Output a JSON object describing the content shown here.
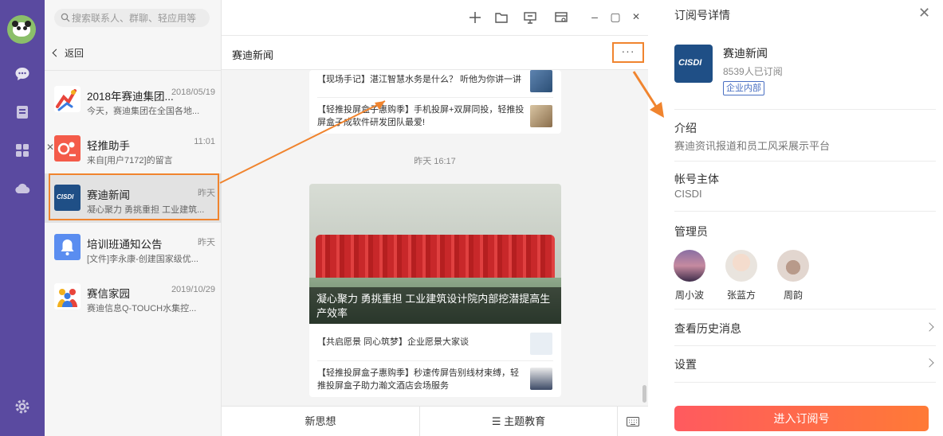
{
  "search": {
    "placeholder": "搜索联系人、群聊、轻应用等"
  },
  "nav": {
    "back_label": "返回"
  },
  "conversations": [
    {
      "name": "2018年赛迪集团...",
      "time": "2018/05/19",
      "preview": "今天，赛迪集团在全国各地..."
    },
    {
      "name": "轻推助手",
      "time": "11:01",
      "preview": "来自[用户7172]的留言"
    },
    {
      "name": "赛迪新闻",
      "time": "昨天",
      "preview": "凝心聚力 勇挑重担 工业建筑..."
    },
    {
      "name": "培训班通知公告",
      "time": "昨天",
      "preview": "[文件]李永康-创建国家级优..."
    },
    {
      "name": "赛信家园",
      "time": "2019/10/29",
      "preview": "赛迪信息Q-TOUCH水集控..."
    }
  ],
  "chat": {
    "title": "赛迪新闻",
    "more": "···",
    "card1": [
      "【现场手记】湛江智慧水务是什么？ 听他为你讲一讲",
      "【轻推投屏盒子惠购季】手机投屏+双屏同投，轻推投屏盒子成软件研发团队最爱!"
    ],
    "timestamp": "昨天 16:17",
    "card2": {
      "headline": "凝心聚力 勇挑重担  工业建筑设计院内部挖潜提高生产效率",
      "items": [
        "【共启愿景 同心筑梦】企业愿景大家谈",
        "【轻推投屏盒子惠购季】秒速传屏告别线材束缚，轻推投屏盒子助力瀚文酒店会场服务"
      ]
    },
    "bottom_menu": [
      "新思想",
      "☰ 主题教育"
    ]
  },
  "detail": {
    "title": "订阅号详情",
    "logo_text": "CISDI",
    "name": "赛迪新闻",
    "subscribers": "8539人已订阅",
    "badge": "企业内部",
    "intro_label": "介绍",
    "intro_value": "赛迪资讯报道和员工风采展示平台",
    "owner_label": "帐号主体",
    "owner_value": "CISDI",
    "admins_label": "管理员",
    "admins": [
      "周小波",
      "张蓝方",
      "周韵"
    ],
    "history_label": "查看历史消息",
    "settings_label": "设置",
    "enter_button": "进入订阅号"
  },
  "colors": {
    "rail": "#5a4aa0",
    "highlight": "#f0842e",
    "accent_button": "#ff5a5f",
    "badge": "#4a6fc2"
  }
}
